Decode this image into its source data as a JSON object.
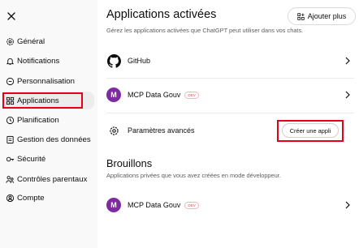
{
  "sidebar": {
    "close_label": "Close",
    "items": [
      {
        "label": "Général",
        "icon": "gear-icon"
      },
      {
        "label": "Notifications",
        "icon": "bell-icon"
      },
      {
        "label": "Personnalisation",
        "icon": "personalize-icon"
      },
      {
        "label": "Applications",
        "icon": "apps-icon",
        "active": true
      },
      {
        "label": "Planification",
        "icon": "clock-icon"
      },
      {
        "label": "Gestion des données",
        "icon": "data-icon"
      },
      {
        "label": "Sécurité",
        "icon": "key-icon"
      },
      {
        "label": "Contrôles parentaux",
        "icon": "family-icon"
      },
      {
        "label": "Compte",
        "icon": "account-icon"
      }
    ]
  },
  "main": {
    "title": "Applications activées",
    "subtitle": "Gérez les applications activées que ChatGPT peut utiliser dans vos chats.",
    "add_button": "Ajouter plus",
    "apps": [
      {
        "name": "GitHub",
        "logo": "github-icon"
      },
      {
        "name": "MCP Data Gouv",
        "logo": "M",
        "badge": "DEV"
      }
    ],
    "advanced": {
      "label": "Paramètres avancés",
      "create_button": "Créer une appli"
    },
    "drafts": {
      "title": "Brouillons",
      "subtitle": "Applications privées que vous avez créées en mode développeur.",
      "apps": [
        {
          "name": "MCP Data Gouv",
          "logo": "M",
          "badge": "DEV"
        }
      ]
    }
  },
  "colors": {
    "highlight": "#e3001b",
    "avatar": "#7e2aa1",
    "badge": "#e54b4b"
  }
}
